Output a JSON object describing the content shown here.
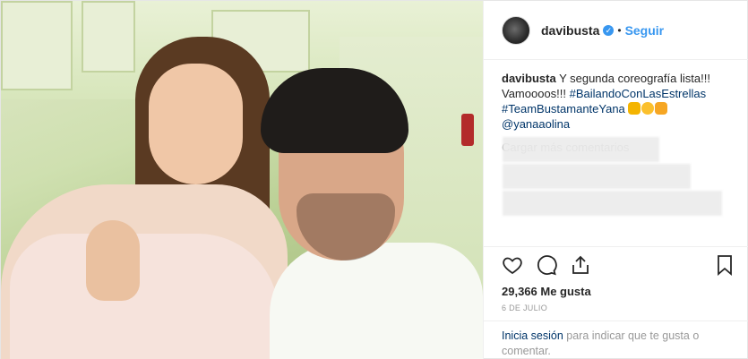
{
  "post": {
    "image_alt": "",
    "username": "davibusta",
    "verified_badge": "✓",
    "separator": "•",
    "follow_label": "Seguir",
    "caption": {
      "username": "davibusta",
      "text_1": " Y segunda coreografía lista!!! Vamoooos!!! ",
      "hashtag_1": "#BailandoConLasEstrellas",
      "text_2": " ",
      "hashtag_2": "#TeamBustamanteYana",
      "emojis": [
        "muscle-emoji",
        "wink-emoji",
        "thumbs-up-emoji"
      ],
      "mention": "@yanaaolina"
    },
    "load_more_label": "Cargar más comentarios",
    "likes_text": "29,366 Me gusta",
    "date_text": "6 DE JULIO",
    "login_prompt": {
      "link_label": "Inicia sesión",
      "text": " para indicar que te gusta o comentar."
    },
    "icons": {
      "like": "heart-icon",
      "comment": "comment-icon",
      "share": "share-icon",
      "save": "bookmark-icon"
    },
    "colors": {
      "link_blue": "#3897f0",
      "text_dark": "#262626",
      "muted": "#999999",
      "hashtag": "#003569"
    }
  }
}
